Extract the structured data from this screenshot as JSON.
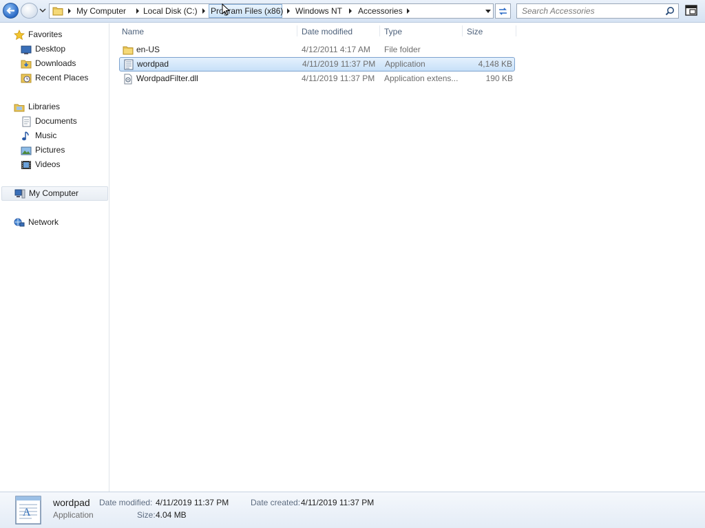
{
  "window": {
    "breadcrumbs": [
      "My Computer",
      "Local Disk (C:)",
      "Program Files (x86)",
      "Windows NT",
      "Accessories"
    ],
    "search_placeholder": "Search Accessories"
  },
  "sidebar": {
    "favorites": {
      "label": "Favorites",
      "icon": "star-icon",
      "items": [
        {
          "label": "Desktop",
          "icon": "desktop-icon"
        },
        {
          "label": "Downloads",
          "icon": "downloads-folder-icon"
        },
        {
          "label": "Recent Places",
          "icon": "recent-places-icon"
        }
      ]
    },
    "libraries": {
      "label": "Libraries",
      "icon": "libraries-icon",
      "items": [
        {
          "label": "Documents",
          "icon": "documents-icon"
        },
        {
          "label": "Music",
          "icon": "music-icon"
        },
        {
          "label": "Pictures",
          "icon": "pictures-icon"
        },
        {
          "label": "Videos",
          "icon": "videos-icon"
        }
      ]
    },
    "computer": {
      "label": "My Computer",
      "icon": "computer-icon",
      "selected": true
    },
    "network": {
      "label": "Network",
      "icon": "network-icon"
    }
  },
  "columns": {
    "name": "Name",
    "date": "Date modified",
    "type": "Type",
    "size": "Size"
  },
  "files": [
    {
      "name": "en-US",
      "date": "4/12/2011 4:17 AM",
      "type": "File folder",
      "size": "",
      "icon": "folder-icon",
      "selected": false
    },
    {
      "name": "wordpad",
      "date": "4/11/2019 11:37 PM",
      "type": "Application",
      "size": "4,148 KB",
      "icon": "application-icon",
      "selected": true
    },
    {
      "name": "WordpadFilter.dll",
      "date": "4/11/2019 11:37 PM",
      "type": "Application extens...",
      "size": "190 KB",
      "icon": "dll-icon",
      "selected": false
    }
  ],
  "details": {
    "name": "wordpad",
    "type": "Application",
    "date_modified_label": "Date modified:",
    "date_modified": "4/11/2019 11:37 PM",
    "size_label": "Size:",
    "size": "4.04 MB",
    "date_created_label": "Date created:",
    "date_created": "4/11/2019 11:37 PM",
    "icon": "wordpad-large-icon"
  },
  "colors": {
    "accent": "#2a6ac6",
    "selection": "#cde4f8",
    "selection_border": "#7da2ce",
    "header_text": "#4c607a"
  }
}
